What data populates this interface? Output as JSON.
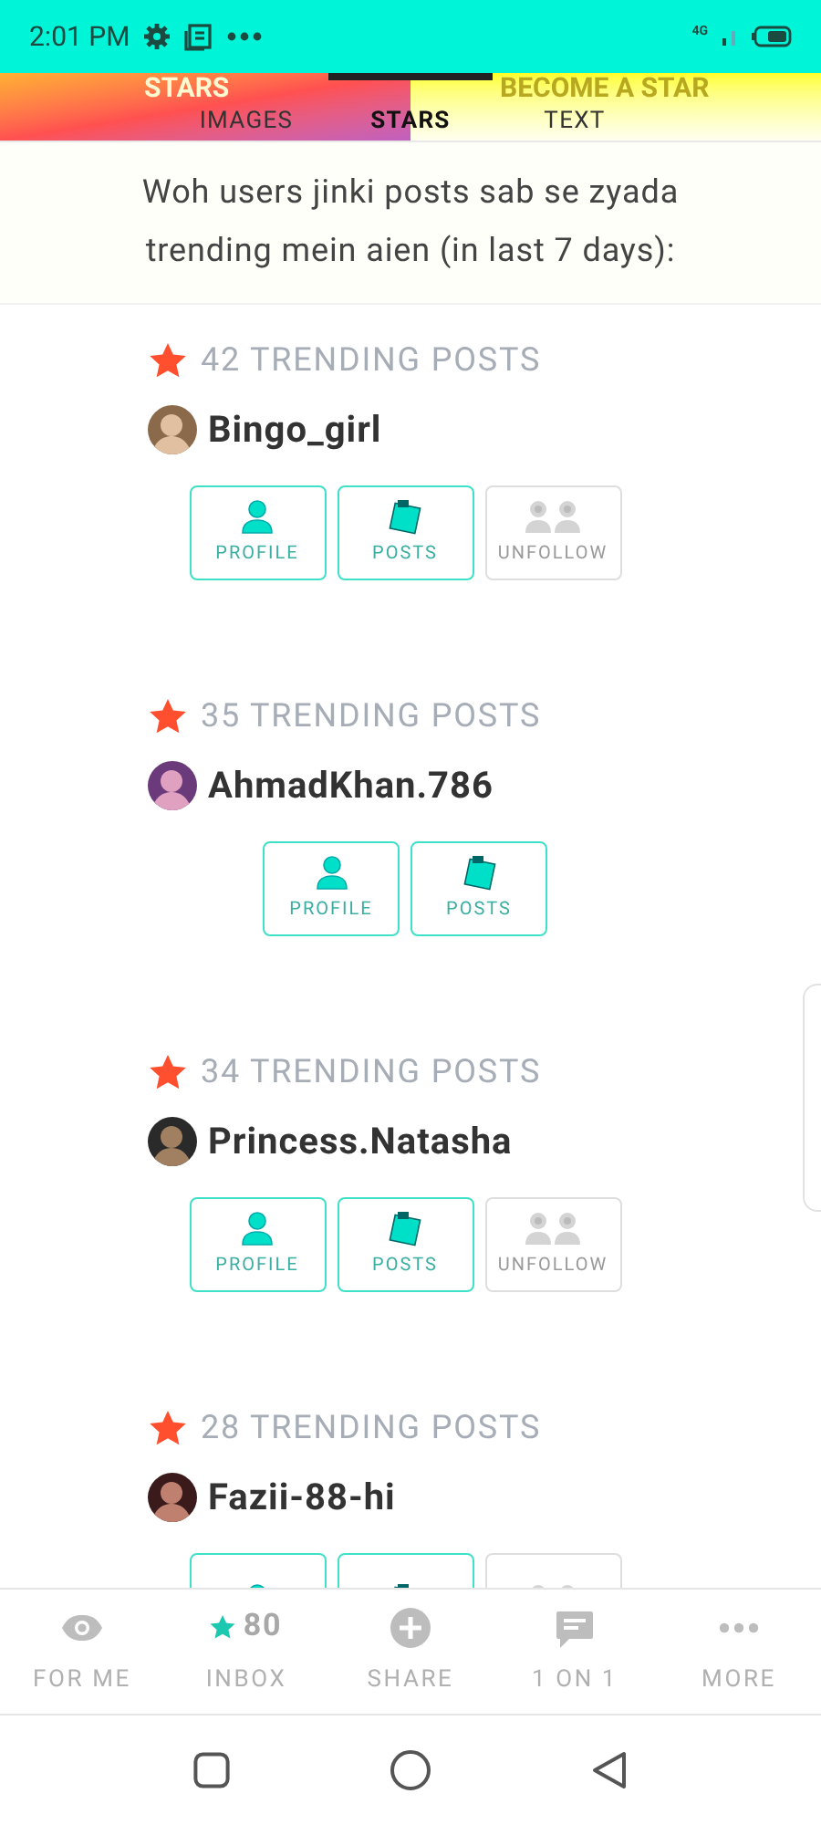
{
  "status_bar": {
    "time": "2:01 PM",
    "network": "4G"
  },
  "header": {
    "back_titles": [
      "STARS",
      "BECOME A STAR"
    ],
    "tabs": [
      {
        "label": "IMAGES",
        "selected": false
      },
      {
        "label": "STARS",
        "selected": true
      },
      {
        "label": "TEXT",
        "selected": false
      }
    ]
  },
  "intro": "Woh users jinki posts sab se zyada trending mein aien (in last 7 days):",
  "stars": [
    {
      "count": "42 TRENDING POSTS",
      "name": "Bingo_girl",
      "buttons": [
        {
          "kind": "profile",
          "label": "PROFILE"
        },
        {
          "kind": "posts",
          "label": "POSTS"
        },
        {
          "kind": "unfollow",
          "label": "UNFOLLOW"
        }
      ]
    },
    {
      "count": "35 TRENDING POSTS",
      "name": "AhmadKhan.786",
      "buttons": [
        {
          "kind": "profile",
          "label": "PROFILE"
        },
        {
          "kind": "posts",
          "label": "POSTS"
        }
      ]
    },
    {
      "count": "34 TRENDING POSTS",
      "name": "Princess.Natasha",
      "buttons": [
        {
          "kind": "profile",
          "label": "PROFILE"
        },
        {
          "kind": "posts",
          "label": "POSTS"
        },
        {
          "kind": "unfollow",
          "label": "UNFOLLOW"
        }
      ]
    },
    {
      "count": "28 TRENDING POSTS",
      "name": "Fazii-88-hi",
      "buttons": [
        {
          "kind": "profile"
        },
        {
          "kind": "posts"
        },
        {
          "kind": "unfollow"
        }
      ]
    }
  ],
  "bottom_nav": [
    {
      "kind": "eye",
      "label": "FOR ME"
    },
    {
      "kind": "inbox",
      "label": "INBOX",
      "count": "80"
    },
    {
      "kind": "plus",
      "label": "SHARE"
    },
    {
      "kind": "chat",
      "label": "1 ON 1"
    },
    {
      "kind": "dots",
      "label": "MORE"
    }
  ]
}
